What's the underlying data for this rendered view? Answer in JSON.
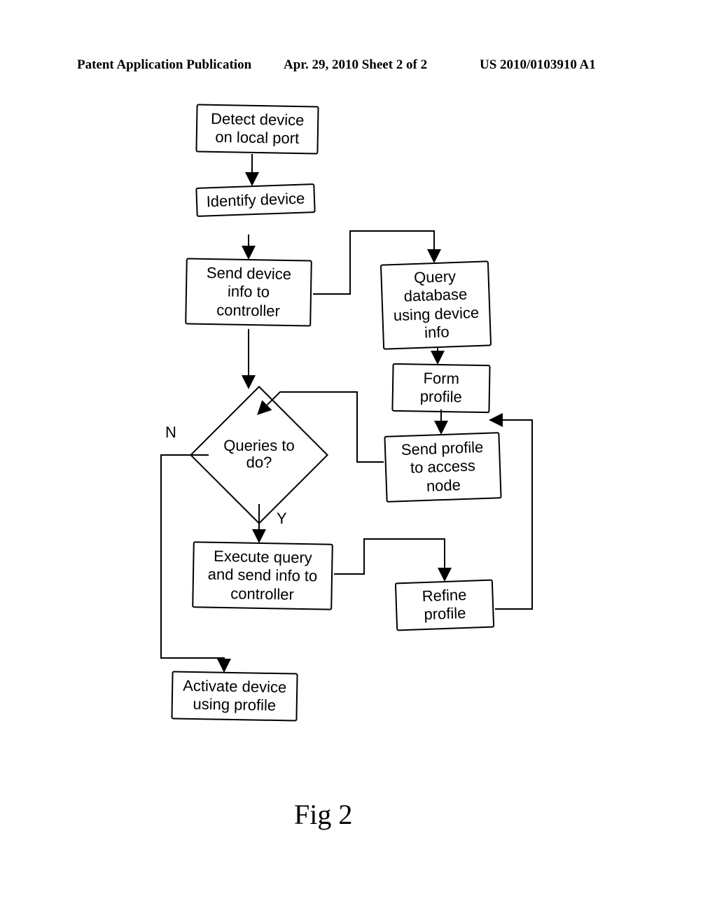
{
  "header": {
    "left": "Patent Application Publication",
    "mid": "Apr. 29, 2010  Sheet 2 of 2",
    "right": "US 2010/0103910 A1"
  },
  "boxes": {
    "detect": "Detect device on local port",
    "identify": "Identify device",
    "send_info": "Send device info to controller",
    "query_db": "Query database using device info",
    "form_profile": "Form profile",
    "send_profile": "Send profile to access node",
    "execute": "Execute query and send info to controller",
    "refine": "Refine profile",
    "activate": "Activate device using profile"
  },
  "decision": {
    "label": "Queries to do?",
    "no": "N",
    "yes": "Y"
  },
  "figure": "Fig 2"
}
